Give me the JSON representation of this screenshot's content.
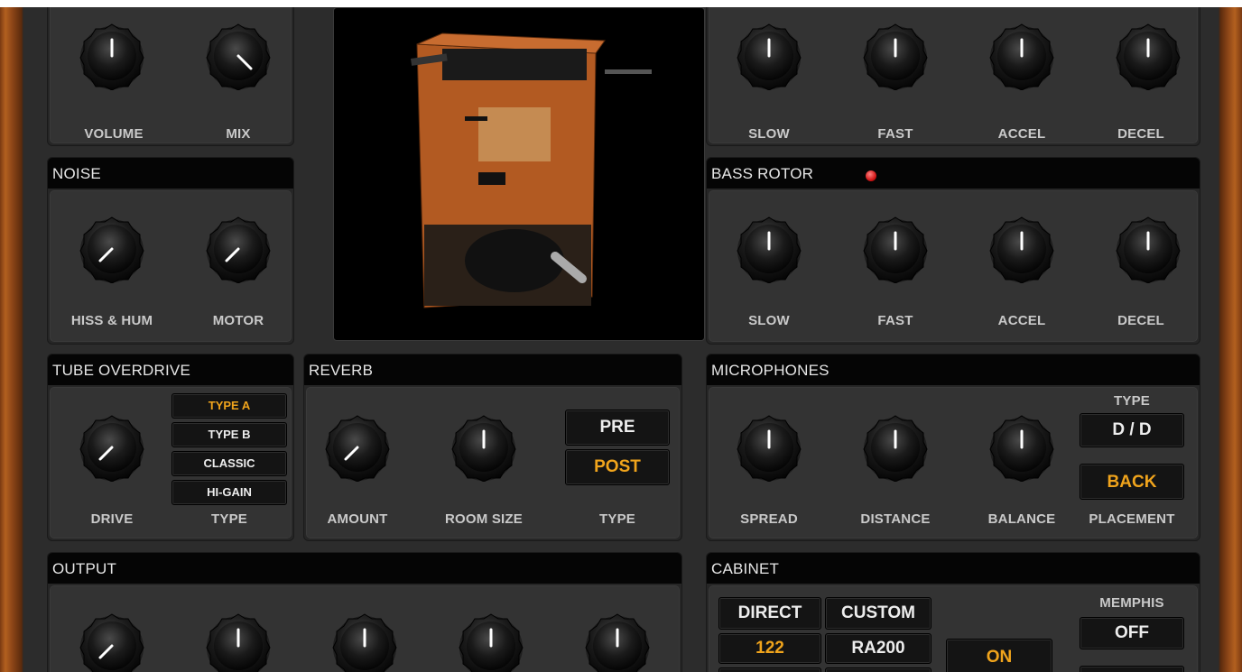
{
  "colors": {
    "accent": "#f0a41c",
    "panel": "#333333",
    "header": "#050505",
    "wood": "#b3601f"
  },
  "top_left": {
    "volume_label": "VOLUME",
    "mix_label": "MIX"
  },
  "top_right": {
    "slow_label": "SLOW",
    "fast_label": "FAST",
    "accel_label": "ACCEL",
    "decel_label": "DECEL"
  },
  "noise": {
    "title": "NOISE",
    "hiss_label": "HISS & HUM",
    "motor_label": "MOTOR"
  },
  "bass_rotor": {
    "title": "BASS ROTOR",
    "slow_label": "SLOW",
    "fast_label": "FAST",
    "accel_label": "ACCEL",
    "decel_label": "DECEL"
  },
  "tube": {
    "title": "TUBE OVERDRIVE",
    "drive_label": "DRIVE",
    "type_label": "TYPE",
    "types": [
      "TYPE A",
      "TYPE B",
      "CLASSIC",
      "HI-GAIN"
    ],
    "selected_type": "TYPE A"
  },
  "reverb": {
    "title": "REVERB",
    "amount_label": "AMOUNT",
    "room_label": "ROOM SIZE",
    "type_label": "TYPE",
    "pre_label": "PRE",
    "post_label": "POST",
    "selected": "POST"
  },
  "microphones": {
    "title": "MICROPHONES",
    "spread_label": "SPREAD",
    "distance_label": "DISTANCE",
    "balance_label": "BALANCE",
    "type_caption": "TYPE",
    "type_value": "D / D",
    "placement_label": "PLACEMENT",
    "placement_value": "BACK"
  },
  "output": {
    "title": "OUTPUT"
  },
  "cabinet": {
    "title": "CABINET",
    "direct_label": "DIRECT",
    "custom_label": "CUSTOM",
    "model_122": "122",
    "model_ra200": "RA200",
    "on_label": "ON",
    "memphis_label": "MEMPHIS",
    "memphis_value": "OFF"
  },
  "knob_icon": "rotary-knob-icon",
  "cabinet_image": "rotary-speaker-cabinet-image"
}
